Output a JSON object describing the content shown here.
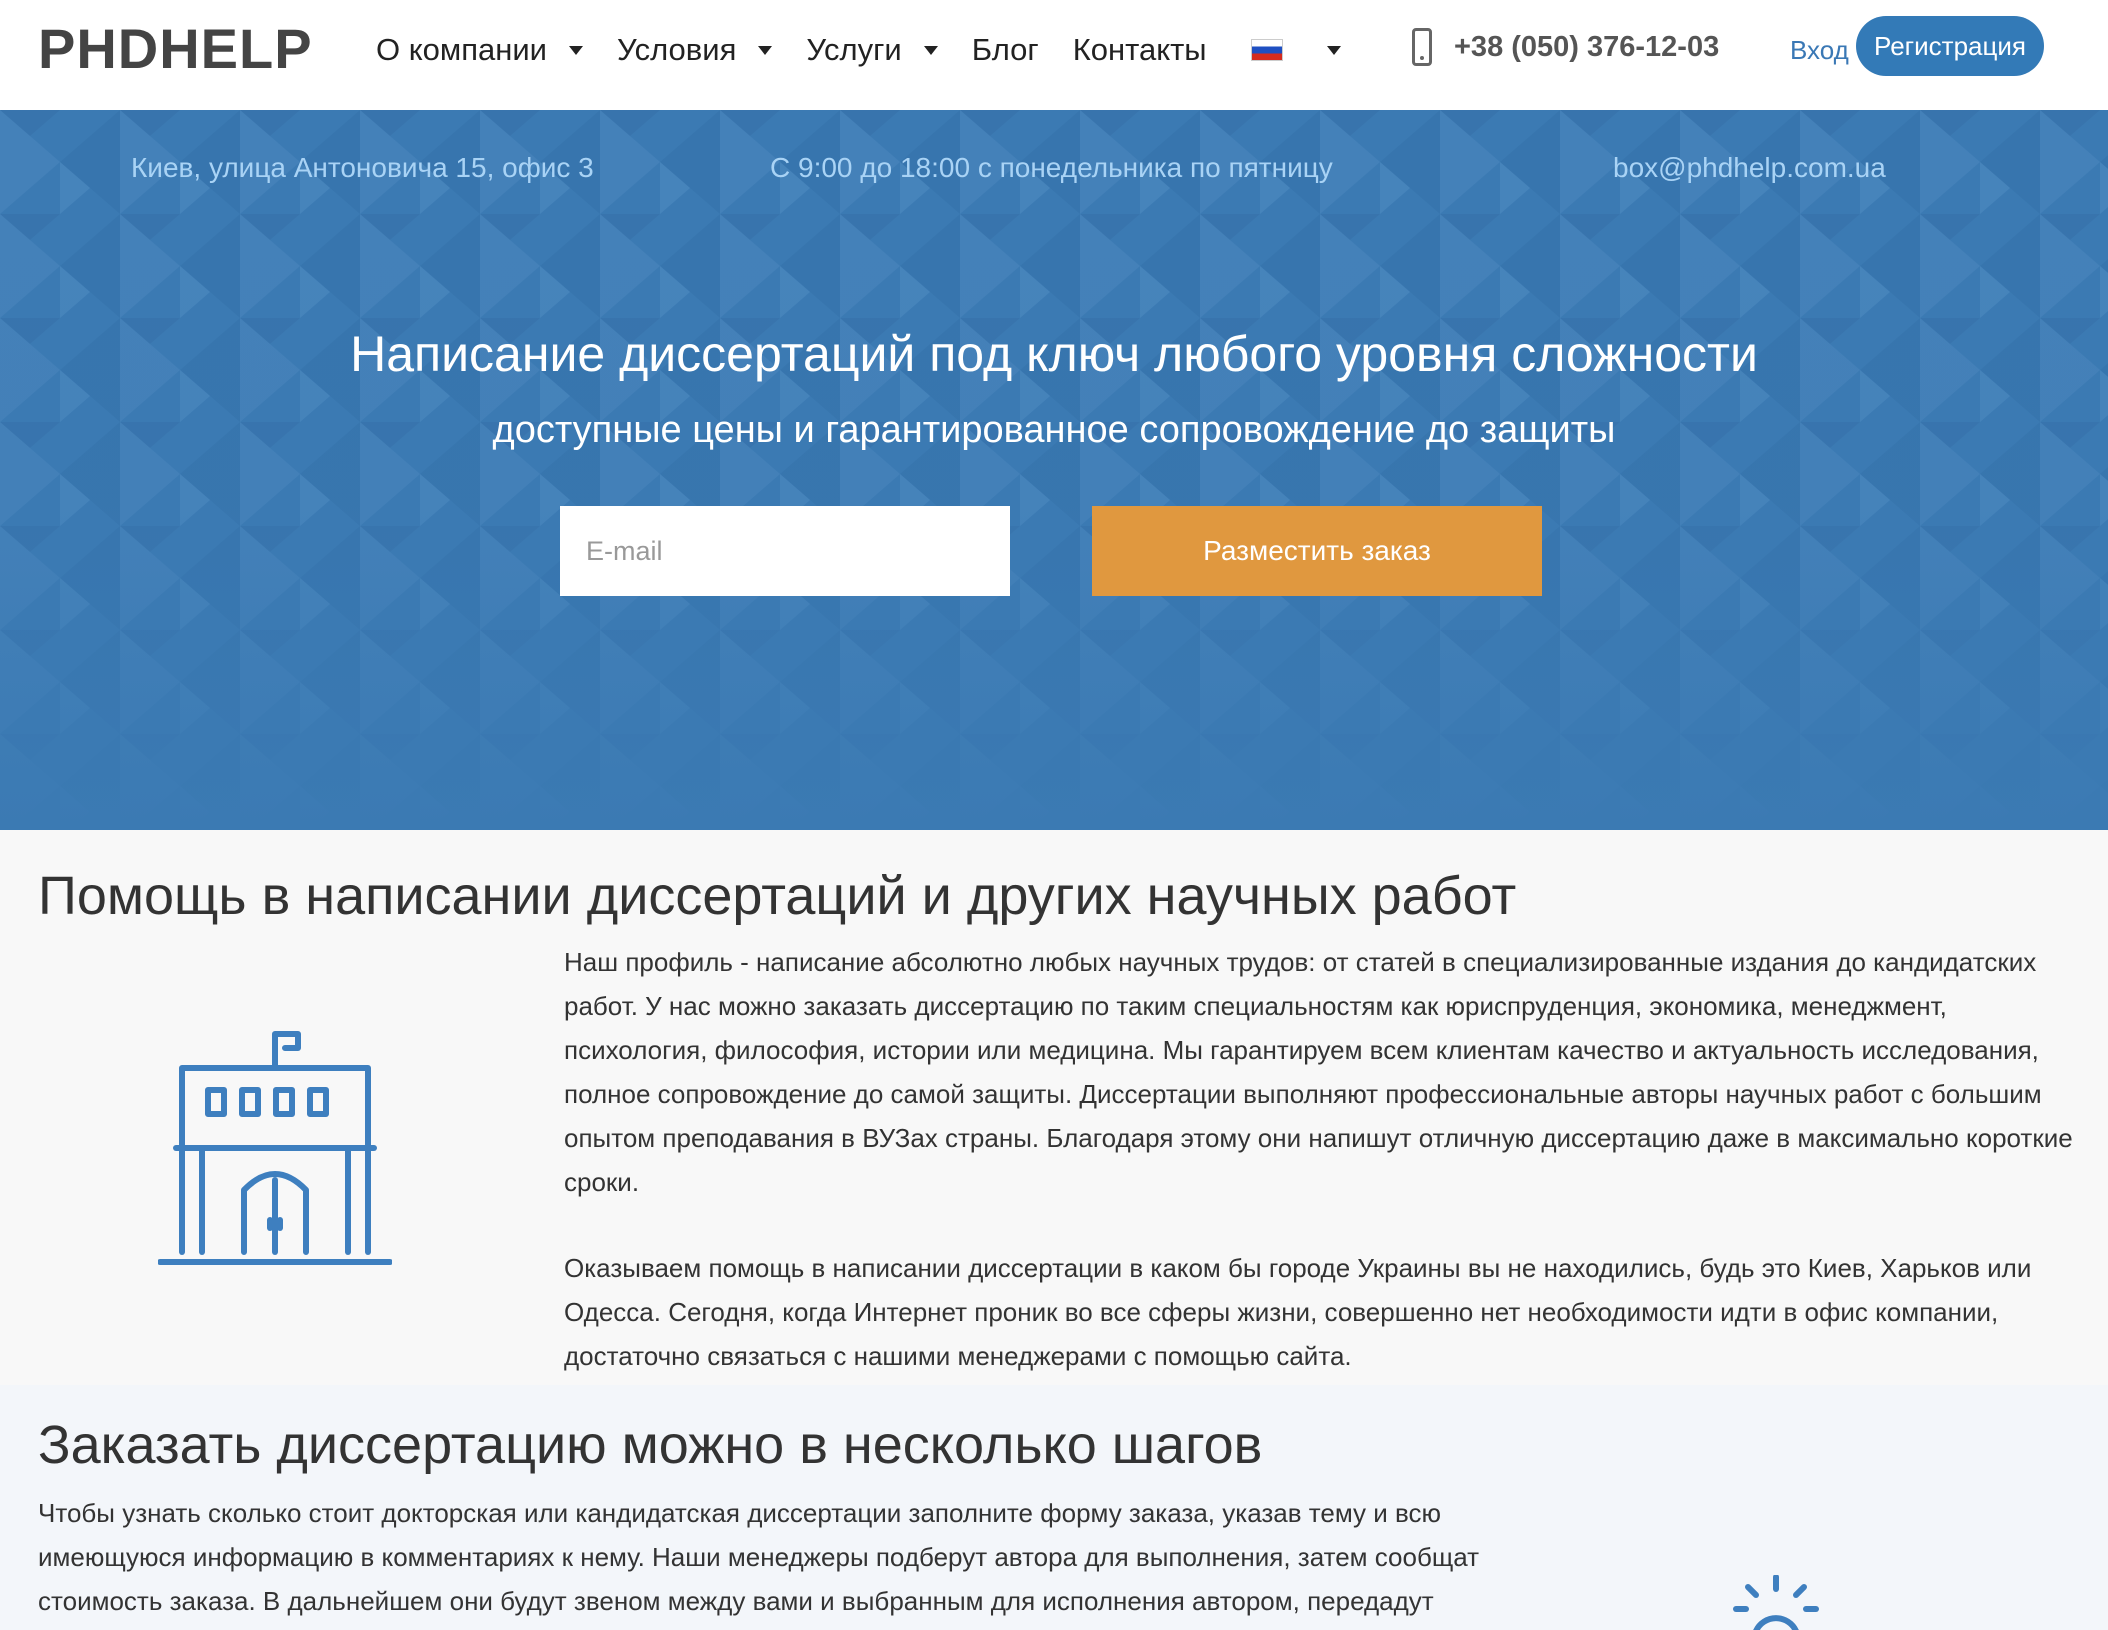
{
  "header": {
    "logo": "PHDHELP",
    "nav": [
      {
        "label": "О компании",
        "dropdown": true
      },
      {
        "label": "Условия",
        "dropdown": true
      },
      {
        "label": "Услуги",
        "dropdown": true
      },
      {
        "label": "Блог",
        "dropdown": false
      },
      {
        "label": "Контакты",
        "dropdown": false
      }
    ],
    "language_flag": "russian-flag-icon",
    "phone": "+38 (050) 376-12-03",
    "login": "Вход",
    "register": "Регистрация"
  },
  "hero": {
    "address": "Киев, улица Антоновича 15, офис 3",
    "hours": "С 9:00 до 18:00 с понедельника по пятницу",
    "email": "box@phdhelp.com.ua",
    "title": "Написание диссертаций под ключ любого уровня сложности",
    "subtitle": "доступные цены и гарантированное сопровождение до защиты",
    "email_input": {
      "placeholder": "E-mail",
      "value": ""
    },
    "order_button": "Разместить заказ"
  },
  "about": {
    "heading": "Помощь в написании диссертаций и других научных работ",
    "icon": "university-building-icon",
    "paragraphs": [
      "Наш профиль - написание абсолютно любых научных трудов: от статей в специализированные издания до кандидатских работ. У нас можно заказать диссертацию по таким специальностям как юриспруденция, экономика, менеджмент, психология, философия, истории или медицина. Мы гарантируем всем клиентам качество и актуальность исследования, полное сопровождение до самой защиты. Диссертации выполняют профессиональные авторы научных работ с большим опытом преподавания в ВУЗах страны. Благодаря этому они напишут отличную диссертацию даже в максимально короткие сроки.",
      "Оказываем помощь в написании диссертации в каком бы городе Украины вы не находились, будь это Киев, Харьков или Одесса. Сегодня, когда Интернет проник во все сферы жизни, совершенно нет необходимости идти в офис компании, достаточно связаться с нашими менеджерами с помощью сайта."
    ]
  },
  "steps": {
    "heading": "Заказать диссертацию можно в несколько шагов",
    "paragraph": "Чтобы узнать сколько стоит докторская или кандидатская диссертации заполните форму заказа, указав тему и всю имеющуюся информацию в комментариях к нему. Наши менеджеры подберут автора для выполнения, затем сообщат стоимость заказа. В дальнейшем они будут звеном между вами и выбранным для исполнения автором, передадут",
    "icon": "lightbulb-icon"
  },
  "colors": {
    "hero_bg": "#3b7ab3",
    "accent_blue": "#337ab7",
    "order_button": "#e0983f",
    "icon_blue": "#3e7fbf"
  }
}
